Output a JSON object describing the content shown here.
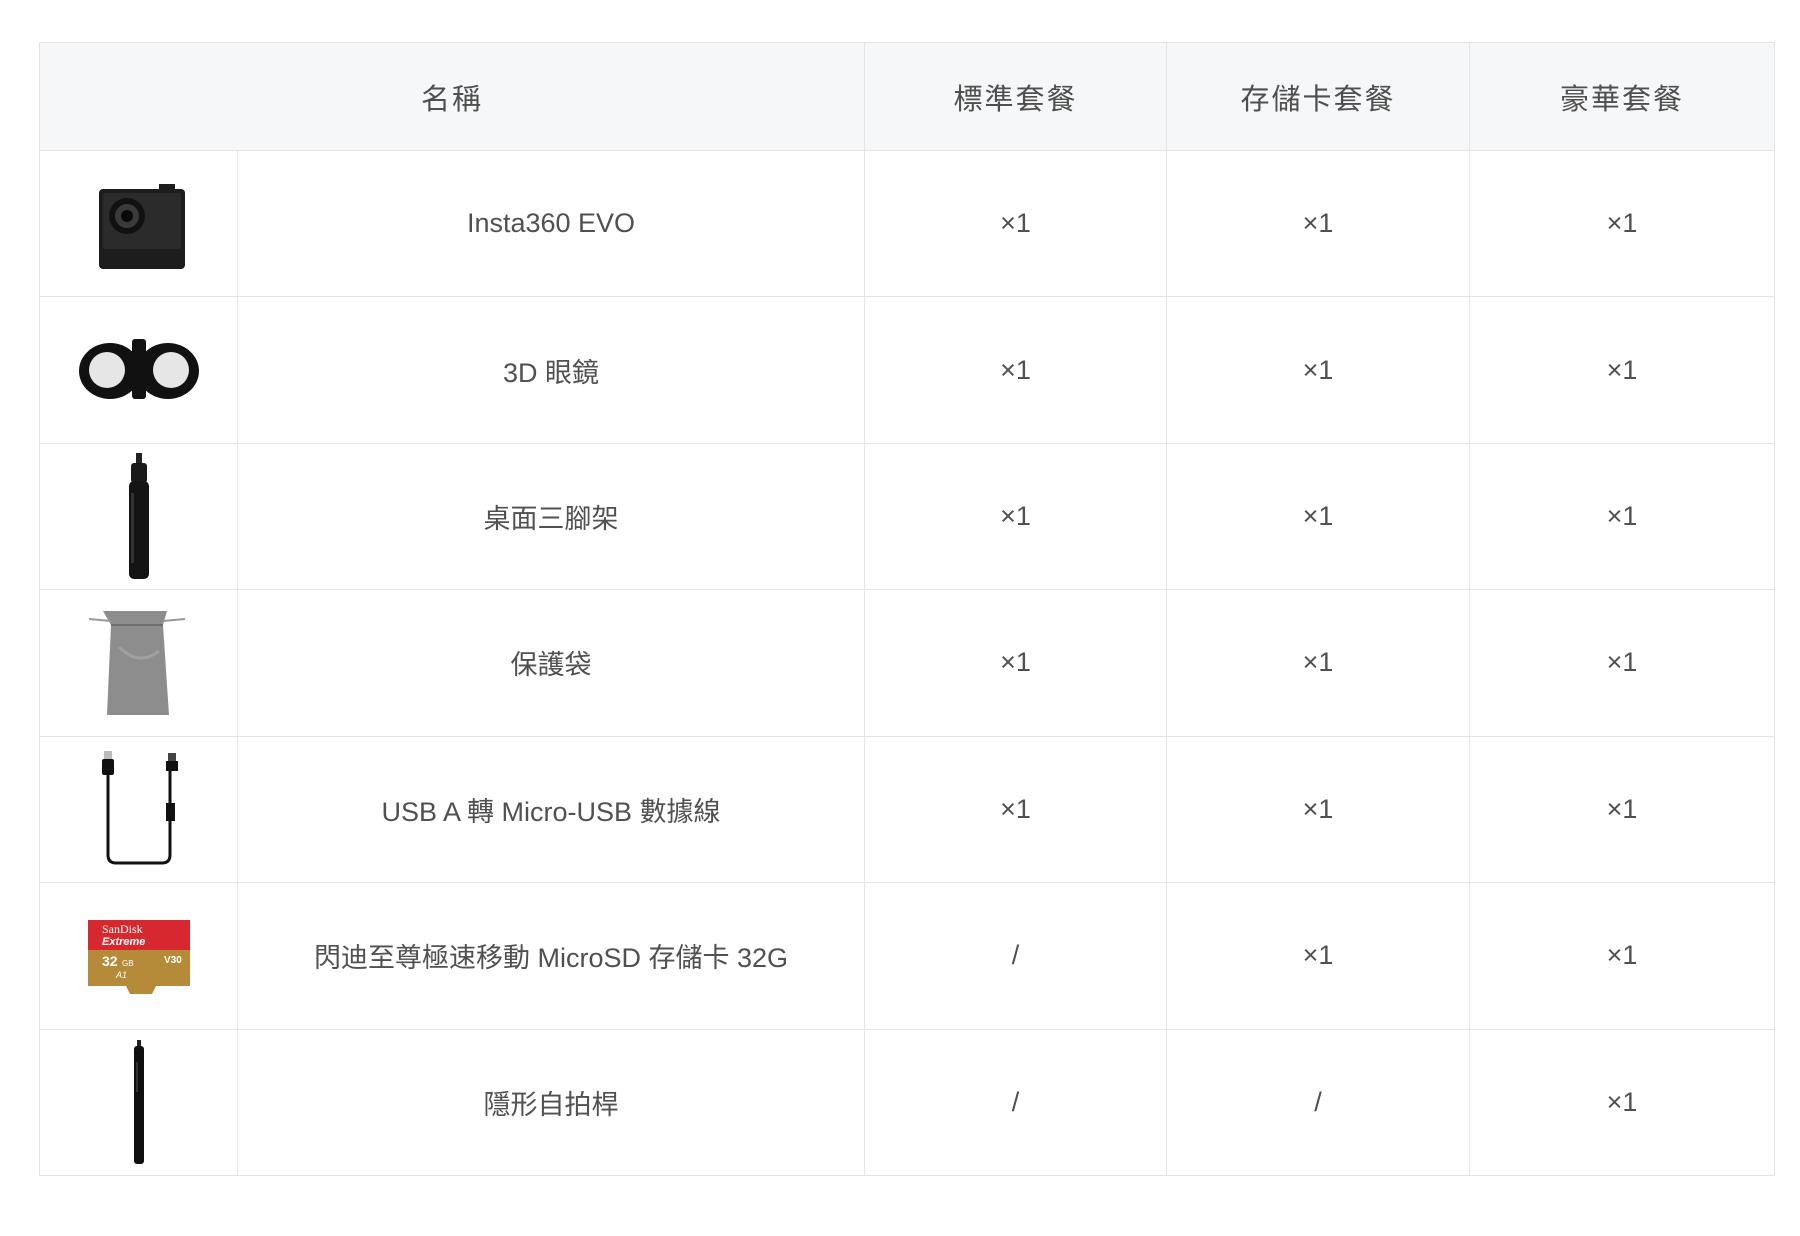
{
  "header": {
    "name": "名稱",
    "standard": "標準套餐",
    "storage": "存儲卡套餐",
    "deluxe": "豪華套餐"
  },
  "rows": [
    {
      "icon": "camera-icon",
      "name": "Insta360 EVO",
      "standard": "×1",
      "storage": "×1",
      "deluxe": "×1"
    },
    {
      "icon": "3d-glasses-icon",
      "name": "3D 眼鏡",
      "standard": "×1",
      "storage": "×1",
      "deluxe": "×1"
    },
    {
      "icon": "tripod-icon",
      "name": "桌面三腳架",
      "standard": "×1",
      "storage": "×1",
      "deluxe": "×1"
    },
    {
      "icon": "pouch-icon",
      "name": "保護袋",
      "standard": "×1",
      "storage": "×1",
      "deluxe": "×1"
    },
    {
      "icon": "usb-cable-icon",
      "name": "USB A 轉 Micro-USB 數據線",
      "standard": "×1",
      "storage": "×1",
      "deluxe": "×1"
    },
    {
      "icon": "sd-card-icon",
      "name": "閃迪至尊極速移動 MicroSD 存儲卡 32G",
      "standard": "/",
      "storage": "×1",
      "deluxe": "×1"
    },
    {
      "icon": "selfie-stick-icon",
      "name": "隱形自拍桿",
      "standard": "/",
      "storage": "/",
      "deluxe": "×1"
    }
  ],
  "sd_card_label": {
    "brand": "SanDisk",
    "line": "Extreme",
    "capacity": "32",
    "unit": "GB",
    "speed": "V30",
    "class": "A1"
  }
}
